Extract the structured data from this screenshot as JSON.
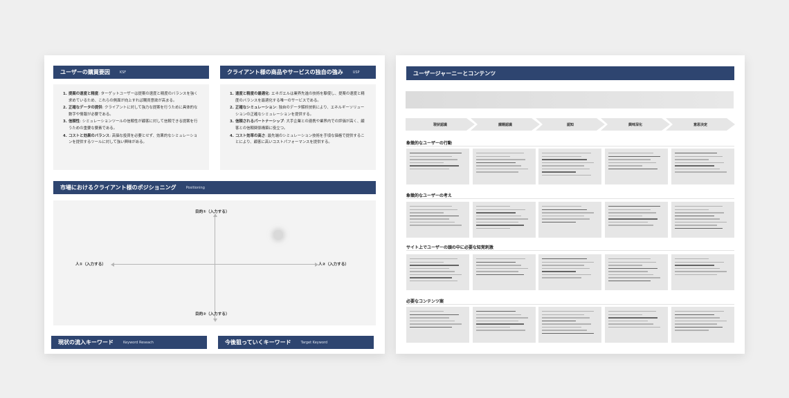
{
  "left_sheet": {
    "ksf": {
      "title": "ユーザーの購買要因",
      "subtitle": "KSF",
      "items": [
        {
          "num": "1.",
          "label": "提案の速度と精度",
          "text": ": ターゲットユーザーは提案の速度と精度のバランスを強く求めているため、これらの側面が向上すれば購買意欲が高まる。"
        },
        {
          "num": "2.",
          "label": "正確なデータの提供",
          "text": ": クライアントに対して強力な提案を行うために具体的な数字や情報が必要である。"
        },
        {
          "num": "3.",
          "label": "信頼性",
          "text": ": シミュレーションツールの信頼性が顧客に対して信頼できる提案を行うための重要な要素である。"
        },
        {
          "num": "4.",
          "label": "コストと効果のバランス",
          "text": ": 高価な投資を必要とせず、効果的なシミュレーションを提供するツールに対して強い興味がある。"
        }
      ]
    },
    "usp": {
      "title": "クライアント様の商品やサービスの独自の強み",
      "subtitle": "USP",
      "items": [
        {
          "num": "1.",
          "label": "速度と精度の最適化",
          "text": ": エネガエルは業界先進の技術を駆使し、提案の速度と精度のバランスを最適化する唯一のサービスである。"
        },
        {
          "num": "2.",
          "label": "正確なシミュレーション",
          "text": ": 独自のデータ解析技術により、エネルギーソリューションの正確なシミュレーションを提供する。"
        },
        {
          "num": "3.",
          "label": "信頼されるパートナーシップ",
          "text": ": 大手企業との連携や業界内での評価が高く、顧客との信頼関係構築に役立つ。"
        },
        {
          "num": "4.",
          "label": "コスト効率の高さ",
          "text": ": 最先端のシミュレーション技術を手頃な価格で提供することにより、顧客に高いコストパフォーマンスを提供する。"
        }
      ]
    },
    "positioning": {
      "title": "市場におけるクライアント様のポジショニング",
      "subtitle": "Positioning",
      "axis_top": "目的①（入力する）",
      "axis_bottom": "目的②（入力する）",
      "axis_left": "人①（入力する）",
      "axis_right": "人②（入力する）"
    },
    "keywords_current": {
      "title": "現状の流入キーワード",
      "subtitle": "Keyword Reseach"
    },
    "keywords_target": {
      "title": "今後狙っていくキーワード",
      "subtitle": "Target Keyword"
    }
  },
  "right_sheet": {
    "title": "ユーザージャーニーとコンテンツ",
    "stages": [
      "現状認識",
      "課題認識",
      "認知",
      "興味深化",
      "意思決定"
    ],
    "sections": [
      "象徴的なユーザーの行動",
      "象徴的なユーザーの考え",
      "サイト上でユーザーの頭の中に必要な知覚刺激",
      "必要なコンテンツ案"
    ]
  },
  "colors": {
    "header_navy": "#2e4570",
    "panel_gray": "#f3f3f3",
    "cell_gray": "#e6e6e6",
    "background": "#efefef"
  }
}
